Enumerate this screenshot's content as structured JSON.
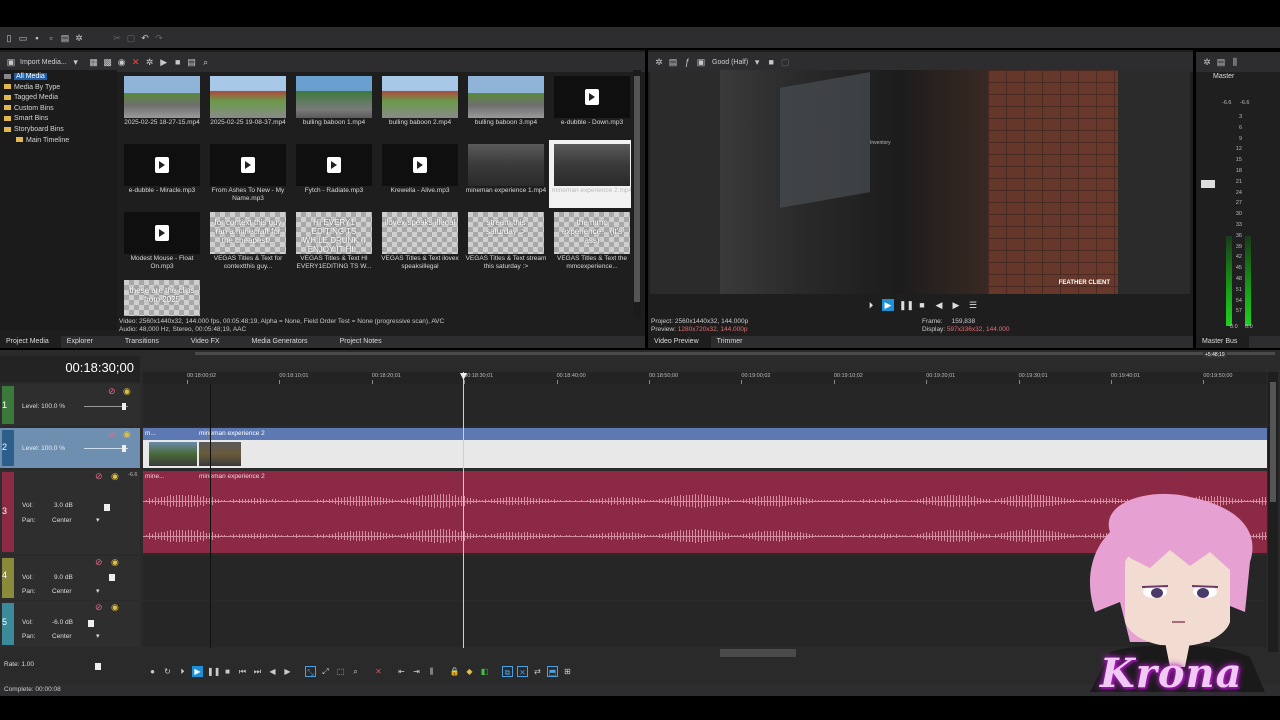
{
  "project_media": {
    "import_label": "Import Media...",
    "tree": [
      "All Media",
      "Media By Type",
      "Tagged Media",
      "Custom Bins",
      "Smart Bins",
      "Storyboard Bins",
      "Main Timeline"
    ],
    "tiles": [
      {
        "caption": "2025-02-25 18-27-15.mp4",
        "kind": "game",
        "overlay": ""
      },
      {
        "caption": "2025-02-25 19-08-37.mp4",
        "kind": "game2",
        "overlay": ""
      },
      {
        "caption": "bulling baboon 1.mp4",
        "kind": "game3",
        "overlay": ""
      },
      {
        "caption": "bulling baboon 2.mp4",
        "kind": "game2",
        "overlay": ""
      },
      {
        "caption": "bulling baboon 3.mp4",
        "kind": "game",
        "overlay": ""
      },
      {
        "caption": "e-dubble - Down.mp3",
        "kind": "audio",
        "overlay": ""
      },
      {
        "caption": "e-dubble - Miracle.mp3",
        "kind": "audio",
        "overlay": ""
      },
      {
        "caption": "From Ashes To New - My Name.mp3",
        "kind": "audio",
        "overlay": ""
      },
      {
        "caption": "Fytch - Radiate.mp3",
        "kind": "audio",
        "overlay": ""
      },
      {
        "caption": "Krewella - Alive.mp3",
        "kind": "audio",
        "overlay": ""
      },
      {
        "caption": "mineman experience 1.mp4",
        "kind": "game4",
        "overlay": ""
      },
      {
        "caption": "mineman experience 2.mp4",
        "kind": "game4",
        "overlay": ""
      },
      {
        "caption": "Modest Mouse - Float On.mp3",
        "kind": "audio",
        "overlay": ""
      },
      {
        "caption": "VEGAS Titles & Text for contextthis guy...",
        "kind": "checker",
        "overlay": "for context this guy ran a minecraft for the cheapest..."
      },
      {
        "caption": "VEGAS Titles & Text HI EVERY1EDITING TS W...",
        "kind": "checker",
        "overlay": "HI EVERY1 EDITING TS WHILE DRUNK (i ENJOY IT HI..."
      },
      {
        "caption": "VEGAS Titles & Text ilovex speaksillegal",
        "kind": "checker",
        "overlay": "ilovex speaks illegal"
      },
      {
        "caption": "VEGAS Titles & Text stream this saturday :>",
        "kind": "checker",
        "overlay": "stream this saturday :>"
      },
      {
        "caption": "VEGAS Titles & Text the mmcexperience...",
        "kind": "checker",
        "overlay": "the mmc experience... (it's ass)"
      },
      {
        "caption": "",
        "kind": "checker",
        "overlay": "these are the clips from 2025"
      }
    ],
    "info_line1": "Video: 2560x1440x32, 144.000 fps, 00:05:48;19, Alpha = None, Field Order Test = None (progressive scan), AVC",
    "info_line2": "Audio: 48,000 Hz, Stereo, 00:05:48;19, AAC",
    "tabs": [
      "Project Media",
      "Explorer",
      "Transitions",
      "Video FX",
      "Media Generators",
      "Project Notes"
    ]
  },
  "preview": {
    "quality": "Good (Half)",
    "overlay_inventory": "Inventory",
    "overlay_logo": "FEATHER CLIENT",
    "project_label": "Project:",
    "project_value": "2560x1440x32, 144.000p",
    "preview_label": "Preview:",
    "preview_value": "1280x720x32, 144.000p",
    "frame_label": "Frame:",
    "frame_value": "159,838",
    "display_label": "Display:",
    "display_value": "597x336x32, 144.000",
    "tabs": [
      "Video Preview",
      "Trimmer"
    ]
  },
  "master": {
    "title": "Master",
    "scale": [
      "3",
      "6",
      "9",
      "12",
      "15",
      "18",
      "21",
      "24",
      "27",
      "30",
      "33",
      "36",
      "39",
      "42",
      "45",
      "48",
      "51",
      "54",
      "57"
    ],
    "peak_left": "-6.6",
    "peak_right": "-6.6",
    "bottom_left": "0.0",
    "bottom_right": "0.0",
    "tab": "Master Bus"
  },
  "timeline": {
    "time": "00:18:30;00",
    "ruler": [
      "00:18:00;02",
      "00:18:10;01",
      "00:18:20;01",
      "00:18:30;01",
      "00:18:40;00",
      "00:18:50;00",
      "00:19:00;02",
      "00:19:10;02",
      "00:19:20;01",
      "00:19:30;01",
      "00:19:40;01",
      "00:19:50;00"
    ],
    "loop_marker": "+5:48;19",
    "tracks": [
      {
        "num": "1",
        "label": "Level: 100.0 %"
      },
      {
        "num": "2",
        "label": "Level: 100.0 %"
      },
      {
        "num": "3",
        "vol": "Vol:",
        "vol_value": "3.0 dB",
        "pan": "Pan:",
        "pan_value": "Center",
        "peak": "-6.6"
      },
      {
        "num": "4",
        "vol": "Vol:",
        "vol_value": "9.0 dB",
        "pan": "Pan:",
        "pan_value": "Center"
      },
      {
        "num": "5",
        "vol": "Vol:",
        "vol_value": "-6.0 dB",
        "pan": "Pan:",
        "pan_value": "Center"
      }
    ],
    "video_clip_short": "m...",
    "video_clip_name": "mineman experience 2",
    "audio_clip_short": "mine...",
    "audio_clip_name": "mineman experience 2",
    "rate": "Rate: 1.00"
  },
  "status": "Complete: 00:00:08",
  "overlay_name": "Krona"
}
